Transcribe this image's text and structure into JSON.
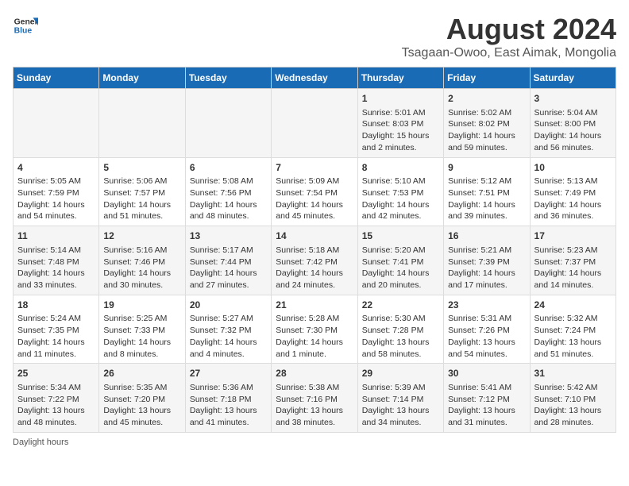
{
  "header": {
    "logo_general": "General",
    "logo_blue": "Blue",
    "title": "August 2024",
    "subtitle": "Tsagaan-Owoo, East Aimak, Mongolia"
  },
  "days_of_week": [
    "Sunday",
    "Monday",
    "Tuesday",
    "Wednesday",
    "Thursday",
    "Friday",
    "Saturday"
  ],
  "weeks": [
    [
      {
        "date": "",
        "info": ""
      },
      {
        "date": "",
        "info": ""
      },
      {
        "date": "",
        "info": ""
      },
      {
        "date": "",
        "info": ""
      },
      {
        "date": "1",
        "info": "Sunrise: 5:01 AM\nSunset: 8:03 PM\nDaylight: 15 hours\nand 2 minutes."
      },
      {
        "date": "2",
        "info": "Sunrise: 5:02 AM\nSunset: 8:02 PM\nDaylight: 14 hours\nand 59 minutes."
      },
      {
        "date": "3",
        "info": "Sunrise: 5:04 AM\nSunset: 8:00 PM\nDaylight: 14 hours\nand 56 minutes."
      }
    ],
    [
      {
        "date": "4",
        "info": "Sunrise: 5:05 AM\nSunset: 7:59 PM\nDaylight: 14 hours\nand 54 minutes."
      },
      {
        "date": "5",
        "info": "Sunrise: 5:06 AM\nSunset: 7:57 PM\nDaylight: 14 hours\nand 51 minutes."
      },
      {
        "date": "6",
        "info": "Sunrise: 5:08 AM\nSunset: 7:56 PM\nDaylight: 14 hours\nand 48 minutes."
      },
      {
        "date": "7",
        "info": "Sunrise: 5:09 AM\nSunset: 7:54 PM\nDaylight: 14 hours\nand 45 minutes."
      },
      {
        "date": "8",
        "info": "Sunrise: 5:10 AM\nSunset: 7:53 PM\nDaylight: 14 hours\nand 42 minutes."
      },
      {
        "date": "9",
        "info": "Sunrise: 5:12 AM\nSunset: 7:51 PM\nDaylight: 14 hours\nand 39 minutes."
      },
      {
        "date": "10",
        "info": "Sunrise: 5:13 AM\nSunset: 7:49 PM\nDaylight: 14 hours\nand 36 minutes."
      }
    ],
    [
      {
        "date": "11",
        "info": "Sunrise: 5:14 AM\nSunset: 7:48 PM\nDaylight: 14 hours\nand 33 minutes."
      },
      {
        "date": "12",
        "info": "Sunrise: 5:16 AM\nSunset: 7:46 PM\nDaylight: 14 hours\nand 30 minutes."
      },
      {
        "date": "13",
        "info": "Sunrise: 5:17 AM\nSunset: 7:44 PM\nDaylight: 14 hours\nand 27 minutes."
      },
      {
        "date": "14",
        "info": "Sunrise: 5:18 AM\nSunset: 7:42 PM\nDaylight: 14 hours\nand 24 minutes."
      },
      {
        "date": "15",
        "info": "Sunrise: 5:20 AM\nSunset: 7:41 PM\nDaylight: 14 hours\nand 20 minutes."
      },
      {
        "date": "16",
        "info": "Sunrise: 5:21 AM\nSunset: 7:39 PM\nDaylight: 14 hours\nand 17 minutes."
      },
      {
        "date": "17",
        "info": "Sunrise: 5:23 AM\nSunset: 7:37 PM\nDaylight: 14 hours\nand 14 minutes."
      }
    ],
    [
      {
        "date": "18",
        "info": "Sunrise: 5:24 AM\nSunset: 7:35 PM\nDaylight: 14 hours\nand 11 minutes."
      },
      {
        "date": "19",
        "info": "Sunrise: 5:25 AM\nSunset: 7:33 PM\nDaylight: 14 hours\nand 8 minutes."
      },
      {
        "date": "20",
        "info": "Sunrise: 5:27 AM\nSunset: 7:32 PM\nDaylight: 14 hours\nand 4 minutes."
      },
      {
        "date": "21",
        "info": "Sunrise: 5:28 AM\nSunset: 7:30 PM\nDaylight: 14 hours\nand 1 minute."
      },
      {
        "date": "22",
        "info": "Sunrise: 5:30 AM\nSunset: 7:28 PM\nDaylight: 13 hours\nand 58 minutes."
      },
      {
        "date": "23",
        "info": "Sunrise: 5:31 AM\nSunset: 7:26 PM\nDaylight: 13 hours\nand 54 minutes."
      },
      {
        "date": "24",
        "info": "Sunrise: 5:32 AM\nSunset: 7:24 PM\nDaylight: 13 hours\nand 51 minutes."
      }
    ],
    [
      {
        "date": "25",
        "info": "Sunrise: 5:34 AM\nSunset: 7:22 PM\nDaylight: 13 hours\nand 48 minutes."
      },
      {
        "date": "26",
        "info": "Sunrise: 5:35 AM\nSunset: 7:20 PM\nDaylight: 13 hours\nand 45 minutes."
      },
      {
        "date": "27",
        "info": "Sunrise: 5:36 AM\nSunset: 7:18 PM\nDaylight: 13 hours\nand 41 minutes."
      },
      {
        "date": "28",
        "info": "Sunrise: 5:38 AM\nSunset: 7:16 PM\nDaylight: 13 hours\nand 38 minutes."
      },
      {
        "date": "29",
        "info": "Sunrise: 5:39 AM\nSunset: 7:14 PM\nDaylight: 13 hours\nand 34 minutes."
      },
      {
        "date": "30",
        "info": "Sunrise: 5:41 AM\nSunset: 7:12 PM\nDaylight: 13 hours\nand 31 minutes."
      },
      {
        "date": "31",
        "info": "Sunrise: 5:42 AM\nSunset: 7:10 PM\nDaylight: 13 hours\nand 28 minutes."
      }
    ]
  ],
  "footer": {
    "note": "Daylight hours"
  },
  "colors": {
    "header_bg": "#1a6bb5",
    "header_text": "#ffffff",
    "odd_row_bg": "#f5f5f5",
    "even_row_bg": "#ffffff"
  }
}
